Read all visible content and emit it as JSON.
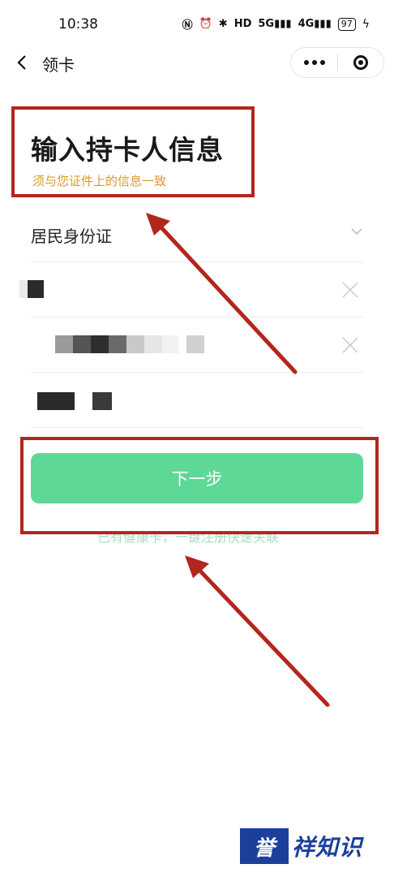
{
  "status_bar": {
    "time": "10:38",
    "battery": "97",
    "net1": "5G",
    "net2": "4G",
    "hd": "HD"
  },
  "nav": {
    "title": "领卡"
  },
  "header": {
    "title": "输入持卡人信息",
    "subtitle": "须与您证件上的信息一致"
  },
  "form": {
    "id_type": "居民身份证"
  },
  "actions": {
    "next_label": "下一步",
    "link_text": "已有健康卡，一键注册快速关联"
  },
  "watermark": {
    "text": "誉祥知识"
  },
  "colors": {
    "button": "#5ed896",
    "subtitle": "#d99a2b",
    "annotation": "#b3261e",
    "brand": "#1d3f9c"
  }
}
